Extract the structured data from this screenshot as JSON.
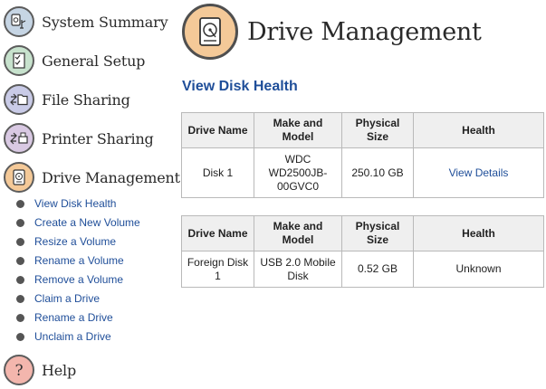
{
  "nav": {
    "items": [
      {
        "id": "system-summary",
        "label": "System Summary",
        "icon": "drive-usb-icon",
        "color": "#c6d5e4"
      },
      {
        "id": "general-setup",
        "label": "General Setup",
        "icon": "checklist-icon",
        "color": "#c7e2cd"
      },
      {
        "id": "file-sharing",
        "label": "File Sharing",
        "icon": "folder-arrows-icon",
        "color": "#c9cbe7"
      },
      {
        "id": "printer-sharing",
        "label": "Printer Sharing",
        "icon": "printer-arrows-icon",
        "color": "#d9c9e3"
      },
      {
        "id": "drive-management",
        "label": "Drive Management",
        "icon": "hard-drive-icon",
        "color": "#f4c998"
      },
      {
        "id": "help",
        "label": "Help",
        "icon": "question-mark-icon",
        "color": "#f3b6ad"
      }
    ],
    "drive_submenu": [
      "View Disk Health",
      "Create a New Volume",
      "Resize a Volume",
      "Rename a Volume",
      "Remove a Volume",
      "Claim a Drive",
      "Rename a Drive",
      "Unclaim a Drive"
    ]
  },
  "header": {
    "title": "Drive Management",
    "icon": "hard-drive-icon"
  },
  "section": {
    "title": "View Disk Health"
  },
  "columns": [
    "Drive Name",
    "Make and Model",
    "Physical Size",
    "Health"
  ],
  "tables": [
    {
      "drive_name": "Disk 1",
      "make_model": "WDC WD2500JB-00GVC0",
      "size": "250.10 GB",
      "health": "View Details",
      "health_is_link": true
    },
    {
      "drive_name": "Foreign Disk 1",
      "make_model": "USB 2.0 Mobile Disk",
      "size": "0.52 GB",
      "health": "Unknown",
      "health_is_link": false
    }
  ]
}
